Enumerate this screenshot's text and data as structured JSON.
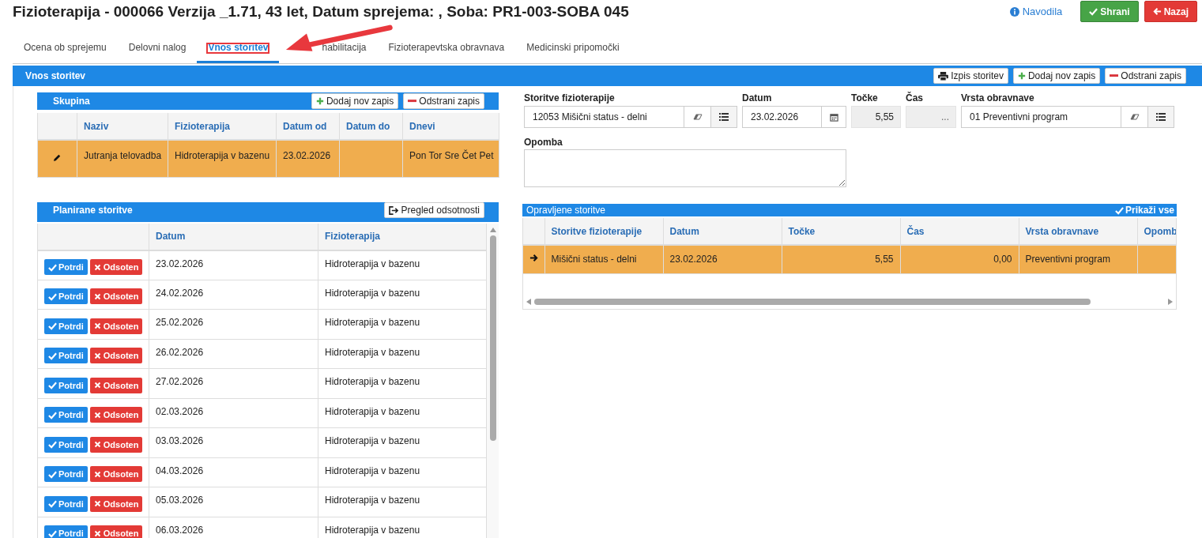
{
  "title": "Fizioterapija - 000066 Verzija _1.71, 43 let, Datum sprejema: , Soba: PR1-003-SOBA 045",
  "help_link": "Navodila",
  "header_buttons": [
    {
      "label": "Shrani",
      "kind": "save"
    },
    {
      "label": "Nazaj",
      "kind": "back"
    }
  ],
  "tabs": [
    {
      "label": "Ocena ob sprejemu",
      "selected": false,
      "highlighted": false
    },
    {
      "label": "Delovni nalog",
      "selected": false,
      "highlighted": false
    },
    {
      "label": "Vnos storitev",
      "selected": true,
      "highlighted": true
    },
    {
      "label": "habilitacija",
      "selected": false,
      "highlighted": false
    },
    {
      "label": "Fizioterapevtska obravnava",
      "selected": false,
      "highlighted": false
    },
    {
      "label": "Medicinski pripomočki",
      "selected": false,
      "highlighted": false
    }
  ],
  "section": {
    "title": "Vnos storitev",
    "buttons": [
      {
        "label": "Izpis storitev",
        "kind": "print"
      },
      {
        "label": "Dodaj nov zapis",
        "kind": "add"
      },
      {
        "label": "Odstrani zapis",
        "kind": "remove"
      }
    ]
  },
  "group_panel": {
    "title": "Skupina",
    "buttons": [
      {
        "label": "Dodaj nov zapis",
        "kind": "add"
      },
      {
        "label": "Odstrani zapis",
        "kind": "remove"
      }
    ],
    "columns": [
      "Naziv",
      "Fizioterapija",
      "Datum od",
      "Datum do",
      "Dnevi"
    ],
    "rows": [
      {
        "selected": true,
        "cells": [
          "Jutranja telovadba",
          "Hidroterapija v bazenu",
          "23.02.2026",
          "",
          "Pon Tor Sre Čet Pet"
        ]
      }
    ]
  },
  "planned_panel": {
    "title": "Planirane storitve",
    "button": {
      "label": "Pregled odsotnosti",
      "kind": "absence"
    },
    "columns": [
      "Datum",
      "Fizioterapija"
    ],
    "rows": [
      {
        "actions": [
          "Potrdi",
          "Odsoten"
        ],
        "date": "23.02.2026",
        "therapy": "Hidroterapija v bazenu"
      },
      {
        "actions": [
          "Potrdi",
          "Odsoten"
        ],
        "date": "24.02.2026",
        "therapy": "Hidroterapija v bazenu"
      },
      {
        "actions": [
          "Potrdi",
          "Odsoten"
        ],
        "date": "25.02.2026",
        "therapy": "Hidroterapija v bazenu"
      },
      {
        "actions": [
          "Potrdi",
          "Odsoten"
        ],
        "date": "26.02.2026",
        "therapy": "Hidroterapija v bazenu"
      },
      {
        "actions": [
          "Potrdi",
          "Odsoten"
        ],
        "date": "27.02.2026",
        "therapy": "Hidroterapija v bazenu"
      },
      {
        "actions": [
          "Potrdi",
          "Odsoten"
        ],
        "date": "02.03.2026",
        "therapy": "Hidroterapija v bazenu"
      },
      {
        "actions": [
          "Potrdi",
          "Odsoten"
        ],
        "date": "03.03.2026",
        "therapy": "Hidroterapija v bazenu"
      },
      {
        "actions": [
          "Potrdi",
          "Odsoten"
        ],
        "date": "04.03.2026",
        "therapy": "Hidroterapija v bazenu"
      },
      {
        "actions": [
          "Potrdi",
          "Odsoten"
        ],
        "date": "05.03.2026",
        "therapy": "Hidroterapija v bazenu"
      },
      {
        "actions": [
          "Potrdi",
          "Odsoten"
        ],
        "date": "06.03.2026",
        "therapy": "Hidroterapija v bazenu"
      }
    ]
  },
  "form": {
    "fields": [
      {
        "label": "Storitve fizioterapije",
        "value": "12053 Mišični status - delni",
        "kind": "lookup"
      },
      {
        "label": "Datum",
        "value": "23.02.2026",
        "kind": "date"
      },
      {
        "label": "Točke",
        "value": "5,55",
        "kind": "readonly"
      },
      {
        "label": "Čas",
        "value": "...",
        "kind": "readonly"
      },
      {
        "label": "Vrsta obravnave",
        "value": "01 Preventivni program",
        "kind": "lookup"
      }
    ],
    "note_label": "Opomba"
  },
  "done_panel": {
    "title": "Opravljene storitve",
    "show_all": {
      "label": "Prikaži vse",
      "checked": true
    },
    "columns": [
      "Storitve fizioterapije",
      "Datum",
      "Točke",
      "Čas",
      "Vrsta obravnave",
      "Opomb"
    ],
    "rows": [
      {
        "selected": true,
        "cells": [
          "Mišični status - delni",
          "23.02.2026",
          "5,55",
          "0,00",
          "Preventivni program",
          ""
        ]
      }
    ]
  }
}
